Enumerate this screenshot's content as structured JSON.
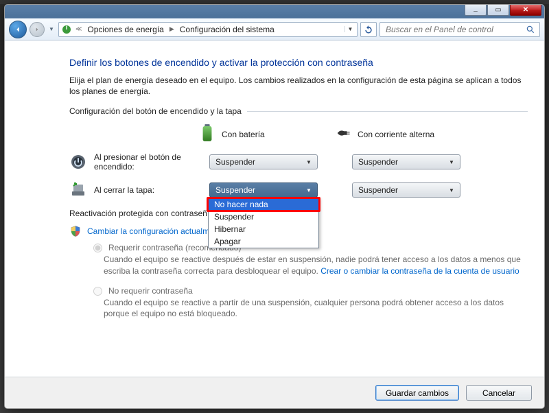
{
  "breadcrumb": {
    "seg1": "Opciones de energía",
    "seg2": "Configuración del sistema"
  },
  "search": {
    "placeholder": "Buscar en el Panel de control"
  },
  "page": {
    "title": "Definir los botones de encendido y activar la protección con contraseña",
    "intro": "Elija el plan de energía deseado en el equipo. Los cambios realizados en la configuración de esta página se aplican a todos los planes de energía."
  },
  "section1": {
    "header": "Configuración del botón de encendido y la tapa",
    "col_battery": "Con batería",
    "col_ac": "Con corriente alterna",
    "row_power_label": "Al presionar el botón de encendido:",
    "row_power_bat": "Suspender",
    "row_power_ac": "Suspender",
    "row_lid_label": "Al cerrar la tapa:",
    "row_lid_bat": "Suspender",
    "row_lid_ac": "Suspender",
    "dropdown_options": {
      "o1": "No hacer nada",
      "o2": "Suspender",
      "o3": "Hibernar",
      "o4": "Apagar"
    }
  },
  "section2": {
    "header": "Reactivación protegida con contraseñ",
    "change_link": "Cambiar la configuración actualm",
    "radio1_label": "Requerir contraseña (recomendado)",
    "radio1_desc_a": "Cuando el equipo se reactive después de estar en suspensión, nadie podrá tener acceso a los datos a menos que escriba la contraseña correcta para desbloquear el equipo. ",
    "radio1_link": "Crear o cambiar la contraseña de la cuenta de usuario",
    "radio2_label": "No requerir contraseña",
    "radio2_desc": "Cuando el equipo se reactive a partir de una suspensión, cualquier persona podrá obtener acceso a los datos porque el equipo no está bloqueado."
  },
  "footer": {
    "save": "Guardar cambios",
    "cancel": "Cancelar"
  }
}
